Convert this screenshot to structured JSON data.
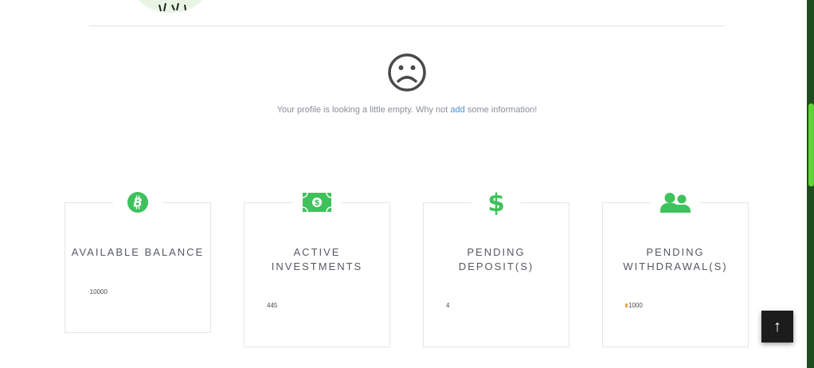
{
  "profile": {
    "empty_prefix": "Your profile is looking a little empty. Why not ",
    "add_link": "add",
    "empty_suffix": " some information!"
  },
  "cards": [
    {
      "title_line1": "AVAILABLE BALANCE",
      "title_line2": "",
      "value": "10000",
      "icon": "bitcoin-icon"
    },
    {
      "title_line1": "ACTIVE",
      "title_line2": "INVESTMENTS",
      "value": "445",
      "icon": "money-bill-icon"
    },
    {
      "title_line1": "PENDING",
      "title_line2": "DEPOSIT(S)",
      "value": "4",
      "icon": "dollar-icon"
    },
    {
      "title_line1": "PENDING",
      "title_line2": "WITHDRAWAL(S)",
      "value": "1000",
      "icon": "users-icon"
    }
  ],
  "scroll_top": {
    "glyph": "↑",
    "icon": "arrow-up-icon"
  },
  "colors": {
    "accent": "#3fc15c",
    "link": "#4a90d9",
    "sidebar": "#1f4d1f",
    "scrollbar": "#5fd336"
  }
}
